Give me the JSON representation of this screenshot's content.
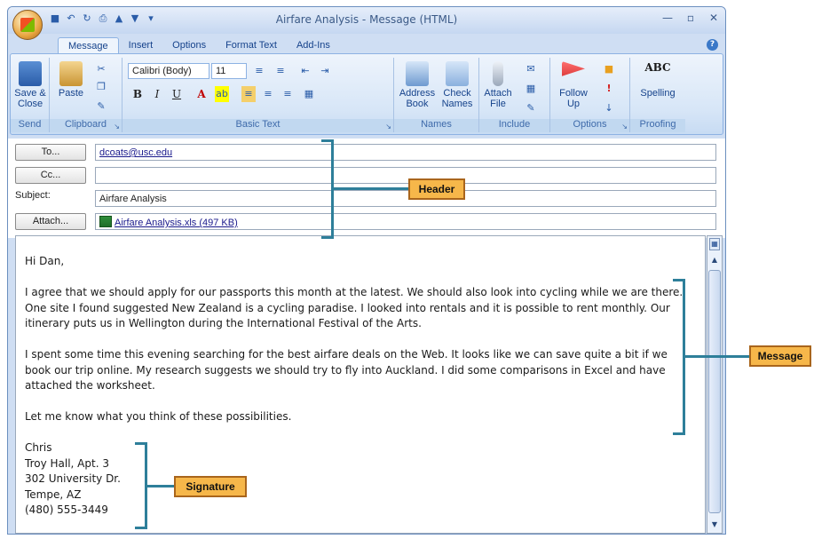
{
  "window": {
    "title": "Airfare Analysis - Message (HTML)"
  },
  "tabs": [
    "Message",
    "Insert",
    "Options",
    "Format Text",
    "Add-Ins"
  ],
  "ribbon": {
    "send": {
      "save_close": "Save & Close",
      "group": "Send"
    },
    "clipboard": {
      "paste": "Paste",
      "group": "Clipboard"
    },
    "basic_text": {
      "font": "Calibri (Body)",
      "size": "11",
      "bold": "B",
      "italic": "I",
      "underline": "U",
      "group": "Basic Text"
    },
    "names": {
      "address_book": "Address Book",
      "check_names": "Check Names",
      "group": "Names"
    },
    "include": {
      "attach_file": "Attach File",
      "group": "Include"
    },
    "options": {
      "follow_up": "Follow Up",
      "group": "Options"
    },
    "proofing": {
      "spelling": "Spelling",
      "abc": "ABC",
      "group": "Proofing"
    }
  },
  "header": {
    "to_button": "To...",
    "to_value": "dcoats@usc.edu",
    "cc_button": "Cc...",
    "cc_value": "",
    "subject_label": "Subject:",
    "subject_value": "Airfare Analysis",
    "attach_button": "Attach...",
    "attachment": "Airfare Analysis.xls (497 KB)"
  },
  "message": {
    "greeting": "Hi Dan,",
    "p1": "I agree that we should apply for our passports this month at the latest. We should also look into cycling while we are there. One site I found suggested New Zealand is a cycling paradise. I looked into rentals and it is possible to rent monthly. Our itinerary puts us in Wellington during the International Festival of the Arts.",
    "p2": "I spent some time this evening searching for the best airfare deals on the Web.  It looks like we can save quite a bit if we book our trip online. My research suggests we should try to fly into Auckland. I did some comparisons in Excel and have attached the worksheet.",
    "p3": "Let me know what you think of these possibilities.",
    "signature": [
      "Chris",
      "Troy Hall, Apt. 3",
      "302 University Dr.",
      "Tempe, AZ",
      "(480) 555-3449"
    ]
  },
  "callouts": {
    "header": "Header",
    "message": "Message",
    "signature": "Signature"
  },
  "colors": {
    "callout_fill": "#f6b74a",
    "bracket": "#2e7f9a",
    "ribbon": "#d7e6f7"
  }
}
